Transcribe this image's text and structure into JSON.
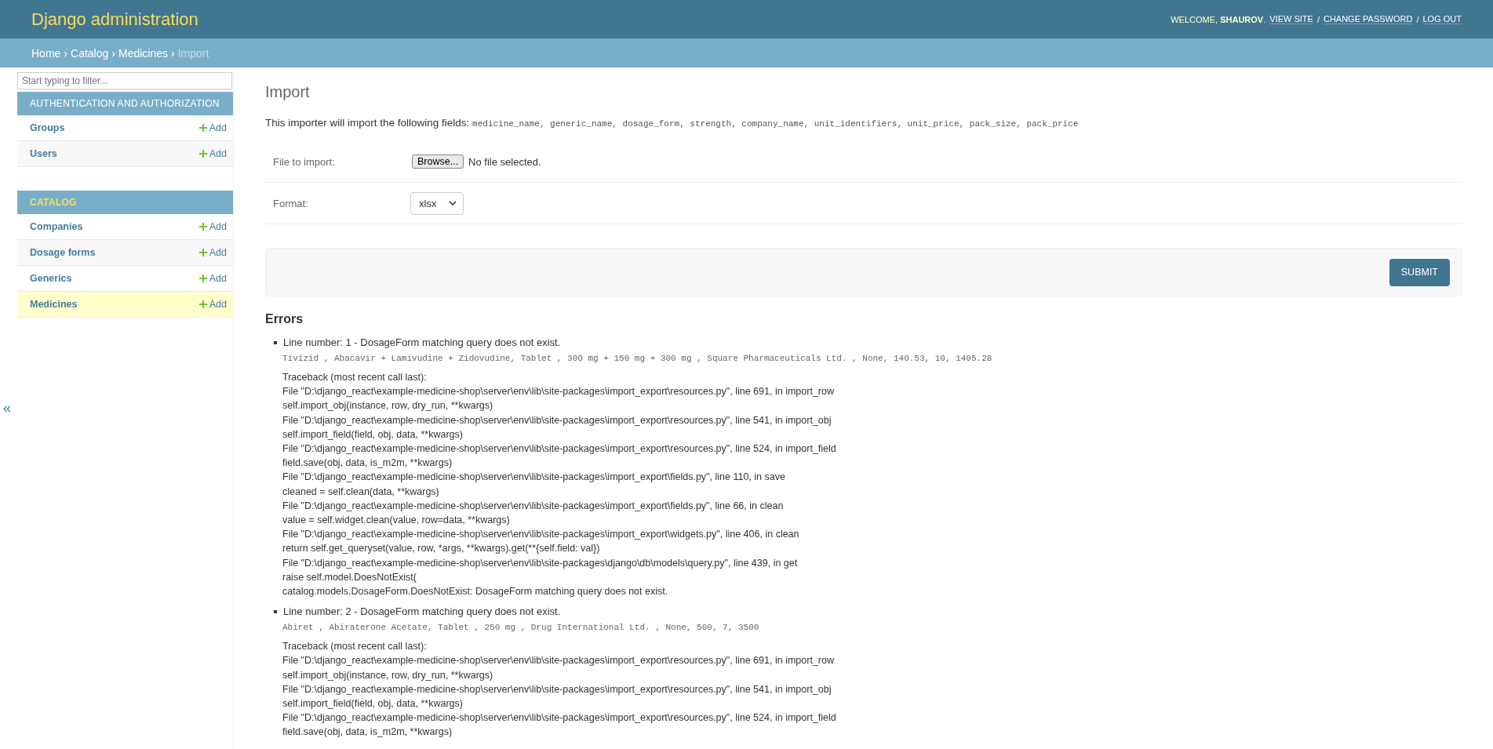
{
  "header": {
    "brand": "Django administration",
    "welcome": "WELCOME, **SHAUROV**.",
    "link_separator": "/",
    "links": [
      "VIEW SITE",
      "CHANGE PASSWORD",
      "LOG OUT"
    ]
  },
  "breadcrumb_separator": "›",
  "breadcrumbs": [
    "Home",
    "Catalog",
    "Medicines",
    "Import"
  ],
  "sidebar": {
    "filter_placeholder": "Start typing to filter...",
    "collapse": "«",
    "apps": [
      {
        "title": "AUTHENTICATION AND AUTHORIZATION",
        "selected": false,
        "models": [
          {
            "name": "Groups",
            "add": "Add",
            "selected": false
          },
          {
            "name": "Users",
            "add": "Add",
            "selected": false
          }
        ]
      },
      {
        "title": "CATALOG",
        "selected": true,
        "models": [
          {
            "name": "Companies",
            "add": "Add",
            "selected": false
          },
          {
            "name": "Dosage forms",
            "add": "Add",
            "selected": false
          },
          {
            "name": "Generics",
            "add": "Add",
            "selected": false
          },
          {
            "name": "Medicines",
            "add": "Add",
            "selected": true
          }
        ]
      }
    ]
  },
  "page_title": "Import",
  "intro": {
    "text": "This importer will import the following fields:",
    "fields": "medicine_name, generic_name, dosage_form, strength, company_name, unit_identifiers, unit_price, pack_size, pack_price"
  },
  "form": {
    "file_label": "File to import:",
    "browse": "Browse...",
    "no_file": "No file selected.",
    "format_label": "Format:",
    "format_value": "xlsx",
    "submit": "SUBMIT"
  },
  "errors": {
    "title": "Errors",
    "items": [
      {
        "message": "Line number: 1 - DosageForm matching query does not exist.",
        "row": "Tivizid , Abacavir + Lamivudine + Zidovudine, Tablet , 300 mg + 150 mg + 300 mg , Square Pharmaceuticals Ltd. , None, 140.53, 10, 1405.28",
        "traceback": [
          "Traceback (most recent call last):",
          "File \"D:\\django_react\\example-medicine-shop\\server\\env\\lib\\site-packages\\import_export\\resources.py\", line 691, in import_row",
          "self.import_obj(instance, row, dry_run, **kwargs)",
          "File \"D:\\django_react\\example-medicine-shop\\server\\env\\lib\\site-packages\\import_export\\resources.py\", line 541, in import_obj",
          "self.import_field(field, obj, data, **kwargs)",
          "File \"D:\\django_react\\example-medicine-shop\\server\\env\\lib\\site-packages\\import_export\\resources.py\", line 524, in import_field",
          "field.save(obj, data, is_m2m, **kwargs)",
          "File \"D:\\django_react\\example-medicine-shop\\server\\env\\lib\\site-packages\\import_export\\fields.py\", line 110, in save",
          "cleaned = self.clean(data, **kwargs)",
          "File \"D:\\django_react\\example-medicine-shop\\server\\env\\lib\\site-packages\\import_export\\fields.py\", line 66, in clean",
          "value = self.widget.clean(value, row=data, **kwargs)",
          "File \"D:\\django_react\\example-medicine-shop\\server\\env\\lib\\site-packages\\import_export\\widgets.py\", line 406, in clean",
          "return self.get_queryset(value, row, *args, **kwargs).get(**{self.field: val})",
          "File \"D:\\django_react\\example-medicine-shop\\server\\env\\lib\\site-packages\\django\\db\\models\\query.py\", line 439, in get",
          "raise self.model.DoesNotExist(",
          "catalog.models.DosageForm.DoesNotExist: DosageForm matching query does not exist."
        ]
      },
      {
        "message": "Line number: 2 - DosageForm matching query does not exist.",
        "row": "Abiret , Abiraterone Acetate, Tablet , 250 mg , Drug International Ltd. , None, 500, 7, 3500",
        "traceback": [
          "Traceback (most recent call last):",
          "File \"D:\\django_react\\example-medicine-shop\\server\\env\\lib\\site-packages\\import_export\\resources.py\", line 691, in import_row",
          "self.import_obj(instance, row, dry_run, **kwargs)",
          "File \"D:\\django_react\\example-medicine-shop\\server\\env\\lib\\site-packages\\import_export\\resources.py\", line 541, in import_obj",
          "self.import_field(field, obj, data, **kwargs)",
          "File \"D:\\django_react\\example-medicine-shop\\server\\env\\lib\\site-packages\\import_export\\resources.py\", line 524, in import_field",
          "field.save(obj, data, is_m2m, **kwargs)"
        ]
      }
    ]
  }
}
